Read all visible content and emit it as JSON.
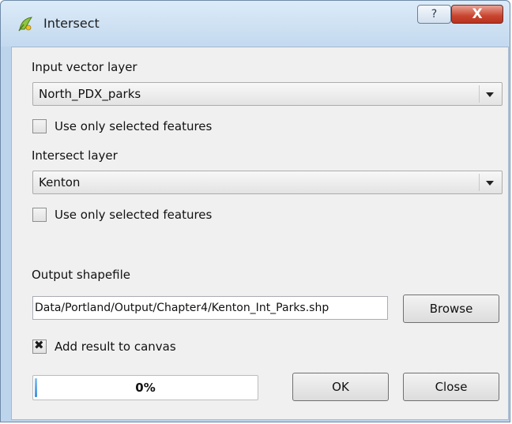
{
  "window": {
    "title": "Intersect",
    "help_glyph": "?",
    "close_glyph": "X"
  },
  "input_layer": {
    "label": "Input vector layer",
    "value": "North_PDX_parks",
    "use_selected_label": "Use only selected features",
    "use_selected_checked": false
  },
  "intersect_layer": {
    "label": "Intersect layer",
    "value": "Kenton",
    "use_selected_label": "Use only selected features",
    "use_selected_checked": false
  },
  "output": {
    "label": "Output shapefile",
    "path": "Data/Portland/Output/Chapter4/Kenton_Int_Parks.shp",
    "browse_label": "Browse"
  },
  "add_to_canvas": {
    "label": "Add result to canvas",
    "checked": true,
    "mark": "✖"
  },
  "progress": {
    "value_percent": 0,
    "text": "0%"
  },
  "buttons": {
    "ok": "OK",
    "close": "Close"
  },
  "colors": {
    "titlebar": "#c3d9ef",
    "client_bg": "#f0f0f0",
    "close_red": "#c8452f",
    "progress_blue": "#3b8fde"
  }
}
